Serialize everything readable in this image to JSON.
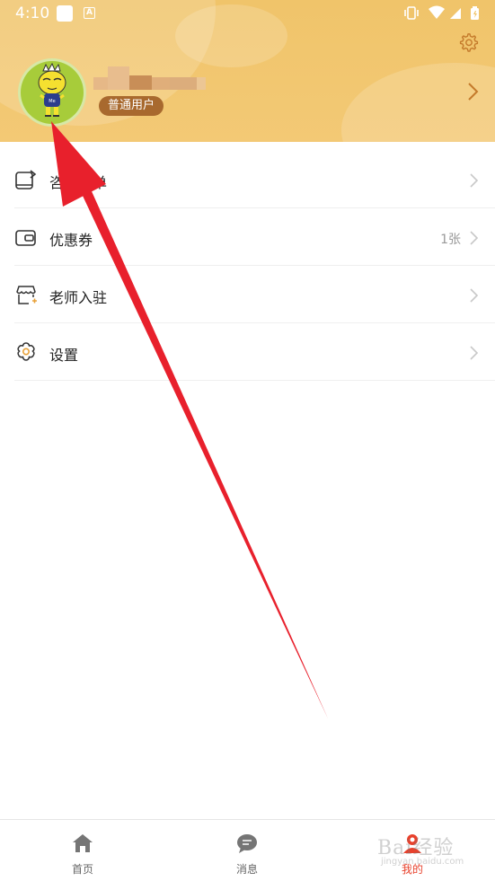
{
  "status_bar": {
    "time": "4:10",
    "a_icon_letter": "A"
  },
  "header": {
    "colors": {
      "bg": "#f0c46a",
      "badge": "#a8692e"
    },
    "user_badge": "普通用户",
    "icons": {
      "settings": "gear-icon",
      "chevron": "chevron-right-icon",
      "avatar": "cartoon-avatar"
    }
  },
  "menu": {
    "items": [
      {
        "label": "咨询订单",
        "value": "",
        "icon": "consult-order-icon"
      },
      {
        "label": "优惠券",
        "value": "1张",
        "icon": "coupon-wallet-icon"
      },
      {
        "label": "老师入驻",
        "value": "",
        "icon": "store-join-icon"
      },
      {
        "label": "设置",
        "value": "",
        "icon": "settings-gear-icon"
      }
    ]
  },
  "tabbar": {
    "active_color": "#e8412c",
    "tabs": [
      {
        "label": "首页",
        "icon": "home-icon"
      },
      {
        "label": "消息",
        "icon": "message-bubble-icon"
      },
      {
        "label": "我的",
        "icon": "profile-icon"
      }
    ]
  },
  "watermark": {
    "text": "Bai经验",
    "sub": "jingyan.baidu.com"
  }
}
